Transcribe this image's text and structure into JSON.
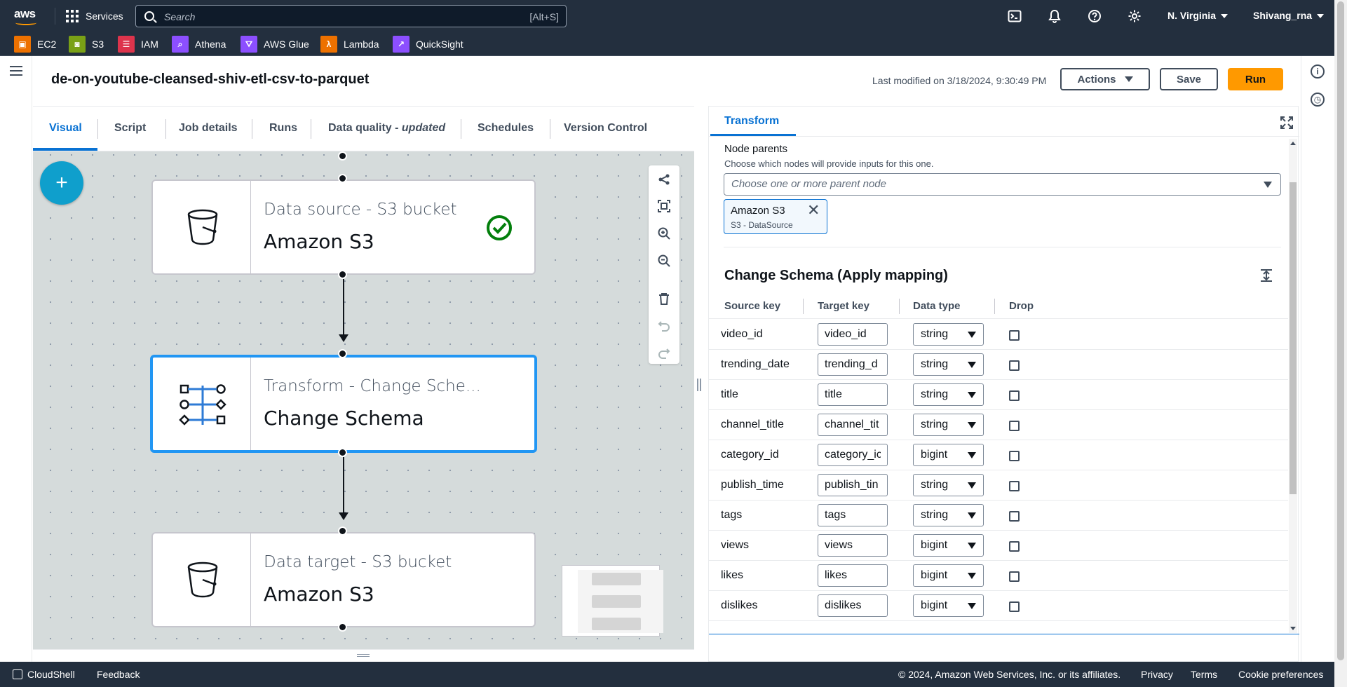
{
  "nav": {
    "brand": "aws",
    "services_label": "Services",
    "search_placeholder": "Search",
    "search_shortcut": "[Alt+S]",
    "region": "N. Virginia",
    "user": "Shivang_rna",
    "favorites": [
      {
        "label": "EC2",
        "color": "#ed7100"
      },
      {
        "label": "S3",
        "color": "#7aa116"
      },
      {
        "label": "IAM",
        "color": "#dd344c"
      },
      {
        "label": "Athena",
        "color": "#8c4fff"
      },
      {
        "label": "AWS Glue",
        "color": "#8c4fff"
      },
      {
        "label": "Lambda",
        "color": "#ed7100"
      },
      {
        "label": "QuickSight",
        "color": "#8c4fff"
      }
    ]
  },
  "header": {
    "job_name": "de-on-youtube-cleansed-shiv-etl-csv-to-parquet",
    "last_modified": "Last modified on 3/18/2024, 9:30:49 PM",
    "actions_label": "Actions",
    "save_label": "Save",
    "run_label": "Run"
  },
  "tabs": {
    "visual": "Visual",
    "script": "Script",
    "job_details": "Job details",
    "runs": "Runs",
    "data_quality": "Data quality - ",
    "data_quality_badge": "updated",
    "schedules": "Schedules",
    "version_control": "Version Control"
  },
  "canvas": {
    "nodes": [
      {
        "kind": "Data source - S3 bucket",
        "name": "Amazon S3",
        "status": "success"
      },
      {
        "kind": "Transform - Change Sche...",
        "name": "Change Schema"
      },
      {
        "kind": "Data target - S3 bucket",
        "name": "Amazon S3"
      }
    ]
  },
  "panel": {
    "tab": "Transform",
    "node_parents_label": "Node parents",
    "node_parents_desc": "Choose which nodes will provide inputs for this one.",
    "node_parents_placeholder": "Choose one or more parent node",
    "token_name": "Amazon S3",
    "token_desc": "S3 - DataSource",
    "section_title": "Change Schema (Apply mapping)",
    "columns": [
      "Source key",
      "Target key",
      "Data type",
      "Drop"
    ],
    "rows": [
      {
        "source": "video_id",
        "target": "video_id",
        "type": "string"
      },
      {
        "source": "trending_date",
        "target": "trending_d",
        "type": "string"
      },
      {
        "source": "title",
        "target": "title",
        "type": "string"
      },
      {
        "source": "channel_title",
        "target": "channel_tit",
        "type": "string"
      },
      {
        "source": "category_id",
        "target": "category_ic",
        "type": "bigint"
      },
      {
        "source": "publish_time",
        "target": "publish_tin",
        "type": "string"
      },
      {
        "source": "tags",
        "target": "tags",
        "type": "string"
      },
      {
        "source": "views",
        "target": "views",
        "type": "bigint"
      },
      {
        "source": "likes",
        "target": "likes",
        "type": "bigint"
      },
      {
        "source": "dislikes",
        "target": "dislikes",
        "type": "bigint"
      }
    ]
  },
  "footer": {
    "cloudshell": "CloudShell",
    "feedback": "Feedback",
    "copyright": "© 2024, Amazon Web Services, Inc. or its affiliates.",
    "privacy": "Privacy",
    "terms": "Terms",
    "cookie": "Cookie preferences"
  },
  "colors": {
    "nav_bg": "#232f3e",
    "primary_blue": "#0972d3",
    "run_orange": "#ff9900",
    "add_button": "#0f9fcc",
    "success_green": "#037f0c",
    "canvas_bg": "#d5dbdb"
  }
}
